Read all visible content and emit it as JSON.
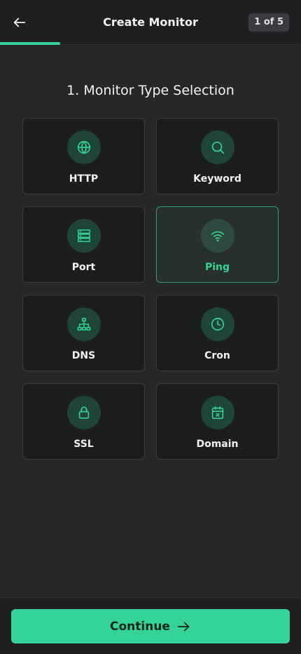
{
  "header": {
    "title": "Create Monitor",
    "step": "1 of 5"
  },
  "section": {
    "title": "1. Monitor Type Selection"
  },
  "monitor_types": [
    {
      "label": "HTTP",
      "icon": "globe-icon",
      "selected": false
    },
    {
      "label": "Keyword",
      "icon": "search-icon",
      "selected": false
    },
    {
      "label": "Port",
      "icon": "server-icon",
      "selected": false
    },
    {
      "label": "Ping",
      "icon": "wifi-icon",
      "selected": true
    },
    {
      "label": "DNS",
      "icon": "network-icon",
      "selected": false
    },
    {
      "label": "Cron",
      "icon": "clock-icon",
      "selected": false
    },
    {
      "label": "SSL",
      "icon": "lock-icon",
      "selected": false
    },
    {
      "label": "Domain",
      "icon": "calendar-x-icon",
      "selected": false
    }
  ],
  "footer": {
    "continue_label": "Continue"
  },
  "colors": {
    "accent": "#34d399",
    "background": "#262729",
    "card": "#1b1d1f",
    "selected_border": "#2f9d72"
  }
}
